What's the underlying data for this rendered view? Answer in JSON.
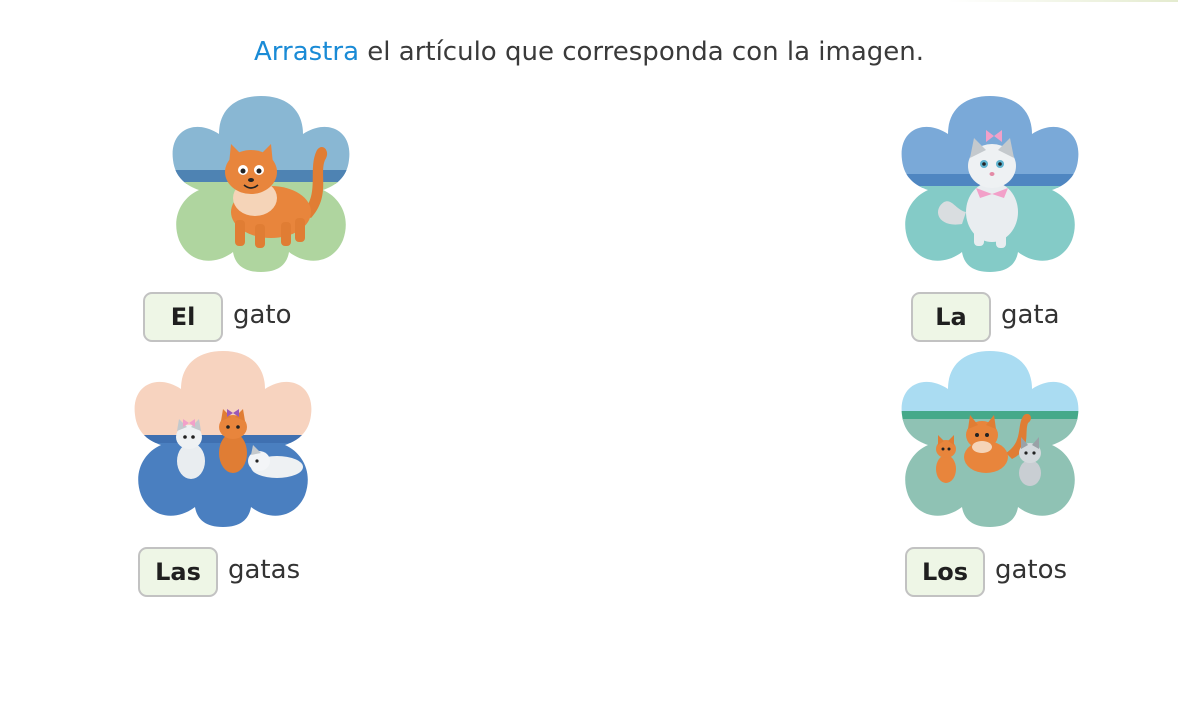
{
  "instruction": {
    "highlight": "Arrastra",
    "rest": " el artículo que corresponda con la imagen."
  },
  "colors": {
    "highlight": "#1a8bd6",
    "tile_background": "#eef6e6",
    "tile_border": "#c2c2c2"
  },
  "items": [
    {
      "article": "El",
      "noun": "gato",
      "image": "orange-cat-flower-icon",
      "sky": "#89b7d3",
      "ground": "#afd59f",
      "stripe": "#4e83b3"
    },
    {
      "article": "La",
      "noun": "gata",
      "image": "white-cat-with-bow-flower-icon",
      "sky": "#7aa9d8",
      "ground": "#84cbc7",
      "stripe": "#4f86c1"
    },
    {
      "article": "Las",
      "noun": "gatas",
      "image": "three-female-cats-flower-icon",
      "sky": "#f7d3bf",
      "ground": "#4a7fc0",
      "stripe": "#3f70b1"
    },
    {
      "article": "Los",
      "noun": "gatos",
      "image": "three-male-cats-flower-icon",
      "sky": "#aadcf2",
      "ground": "#8fc2b4",
      "stripe": "#45a98a"
    }
  ]
}
